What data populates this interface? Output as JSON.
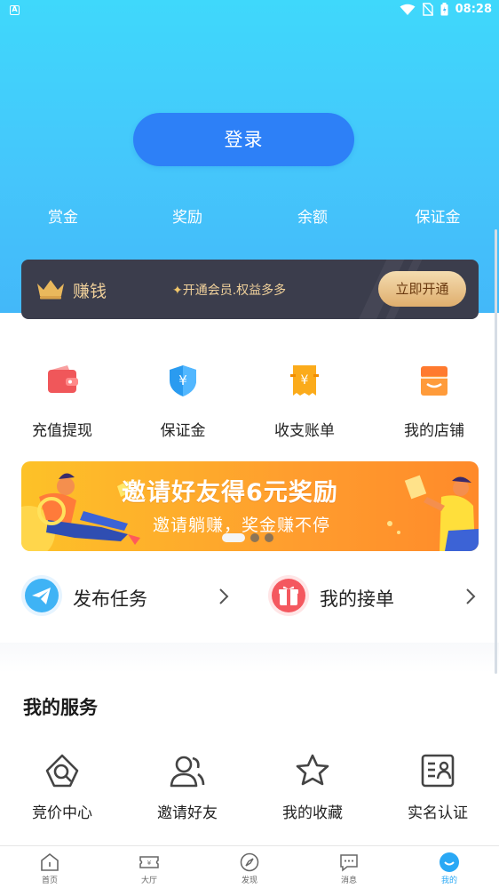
{
  "statusbar": {
    "time": "08:28",
    "app_badge": "A"
  },
  "login": {
    "label": "登录"
  },
  "stats": [
    {
      "label": "赏金"
    },
    {
      "label": "奖励"
    },
    {
      "label": "余额"
    },
    {
      "label": "保证金"
    }
  ],
  "vip": {
    "title": "赚钱",
    "spark": "✦",
    "desc": "开通会员.权益多多",
    "button": "立即开通"
  },
  "quick_actions": [
    {
      "label": "充值提现",
      "icon": "wallet-icon"
    },
    {
      "label": "保证金",
      "icon": "shield-icon"
    },
    {
      "label": "收支账单",
      "icon": "bill-icon"
    },
    {
      "label": "我的店铺",
      "icon": "shop-icon"
    }
  ],
  "banner": {
    "title": "邀请好友得6元奖励",
    "subtitle": "邀请躺赚，奖金赚不停"
  },
  "tasks": [
    {
      "label": "发布任务",
      "icon": "send-icon"
    },
    {
      "label": "我的接单",
      "icon": "gift-icon"
    }
  ],
  "services": {
    "title": "我的服务",
    "items": [
      {
        "label": "竞价中心",
        "icon": "auction-icon"
      },
      {
        "label": "邀请好友",
        "icon": "users-icon"
      },
      {
        "label": "我的收藏",
        "icon": "star-icon"
      },
      {
        "label": "实名认证",
        "icon": "id-card-icon"
      }
    ]
  },
  "nav": [
    {
      "label": "首页",
      "icon": "home-icon"
    },
    {
      "label": "大厅",
      "icon": "ticket-icon"
    },
    {
      "label": "发现",
      "icon": "compass-icon"
    },
    {
      "label": "消息",
      "icon": "message-icon"
    },
    {
      "label": "我的",
      "icon": "profile-icon"
    }
  ],
  "colors": {
    "header_top": "#3fd8fb",
    "primary_button": "#2d80f7",
    "vip_bg": "#3b3d4c",
    "vip_gold": "#f0d19b",
    "active_nav": "#2aa8f5"
  }
}
